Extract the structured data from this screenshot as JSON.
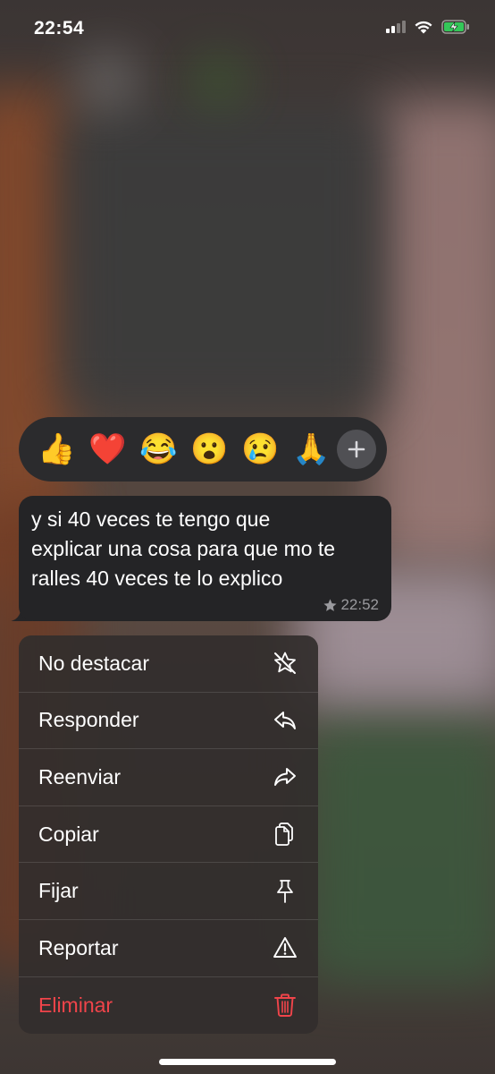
{
  "status_bar": {
    "time": "22:54"
  },
  "reactions": [
    {
      "emoji": "👍",
      "icon": "thumbs-up"
    },
    {
      "emoji": "❤️",
      "icon": "red-heart"
    },
    {
      "emoji": "😂",
      "icon": "tears-of-joy"
    },
    {
      "emoji": "😮",
      "icon": "surprised-face"
    },
    {
      "emoji": "😢",
      "icon": "crying-face"
    },
    {
      "emoji": "🙏",
      "icon": "folded-hands"
    }
  ],
  "message": {
    "lines": [
      "y si 40 veces te tengo que",
      "explicar una cosa para que mo te",
      "ralles 40 veces te lo explico"
    ],
    "time": "22:52",
    "starred": true
  },
  "menu": {
    "items": [
      {
        "label": "No destacar",
        "icon": "unstar-icon"
      },
      {
        "label": "Responder",
        "icon": "reply-icon"
      },
      {
        "label": "Reenviar",
        "icon": "forward-icon"
      },
      {
        "label": "Copiar",
        "icon": "copy-icon"
      },
      {
        "label": "Fijar",
        "icon": "pin-icon"
      },
      {
        "label": "Reportar",
        "icon": "warning-icon"
      },
      {
        "label": "Eliminar",
        "icon": "trash-icon",
        "color": "#f0444a"
      }
    ]
  },
  "colors": {
    "danger": "#f0444a",
    "battery_green": "#34c759"
  }
}
